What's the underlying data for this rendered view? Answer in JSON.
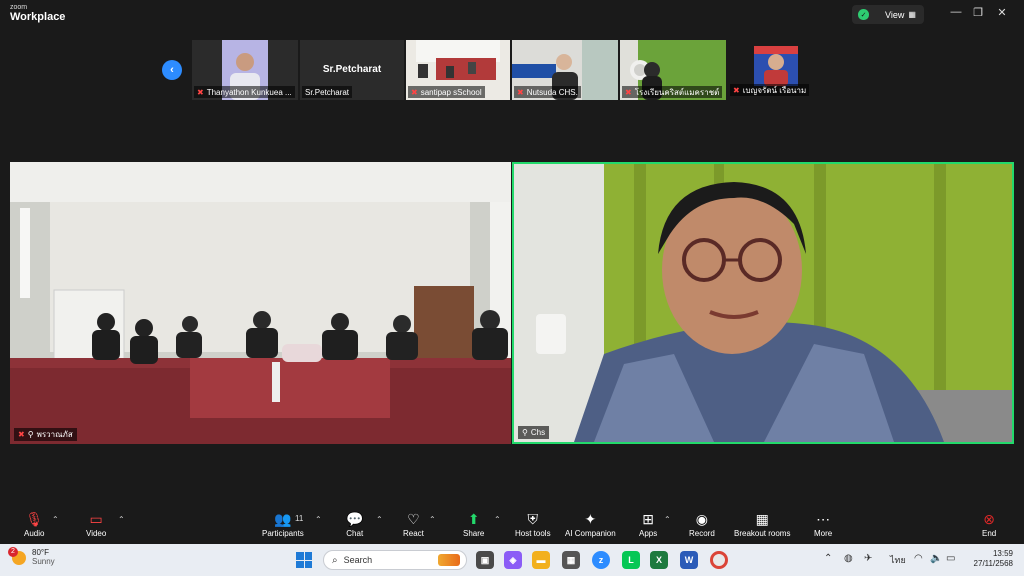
{
  "app": {
    "brand_top": "zoom",
    "brand_main": "Workplace"
  },
  "header": {
    "view_label": "View",
    "view_icon": "grid-icon"
  },
  "gallery": {
    "thumbnails": [
      {
        "name": "Thanyathon Kunkuea ...",
        "muted": true
      },
      {
        "name": "Sr.Petcharat",
        "big_name": "Sr.Petcharat",
        "muted": false
      },
      {
        "name": "santipap sSchool",
        "muted": true
      },
      {
        "name": "Nutsuda CHS.",
        "muted": true
      },
      {
        "name": "โรงเรียนคริสต์แมคราชต์",
        "muted": true
      },
      {
        "name": "เบญจรัตน์ เรือนาม",
        "muted": true
      }
    ]
  },
  "main_videos": [
    {
      "name": "พรวาณภัส",
      "muted": true,
      "pinned": true
    },
    {
      "name": "Chs",
      "muted": false,
      "pinned": true,
      "active_speaker": true
    }
  ],
  "toolbar": {
    "audio": "Audio",
    "video": "Video",
    "participants": "Participants",
    "participants_count": "11",
    "chat": "Chat",
    "react": "React",
    "share": "Share",
    "host_tools": "Host tools",
    "ai_companion": "AI Companion",
    "apps": "Apps",
    "record": "Record",
    "breakout_rooms": "Breakout rooms",
    "more": "More",
    "end": "End"
  },
  "taskbar": {
    "weather_badge": "2",
    "temperature": "80°F",
    "condition": "Sunny",
    "search_placeholder": "Search",
    "language": "ไทย",
    "time": "13:59",
    "date": "27/11/2568"
  },
  "colors": {
    "accent": "#2d8cff",
    "active_speaker": "#23d96b",
    "muted": "#ff4444",
    "end": "#e02828"
  }
}
